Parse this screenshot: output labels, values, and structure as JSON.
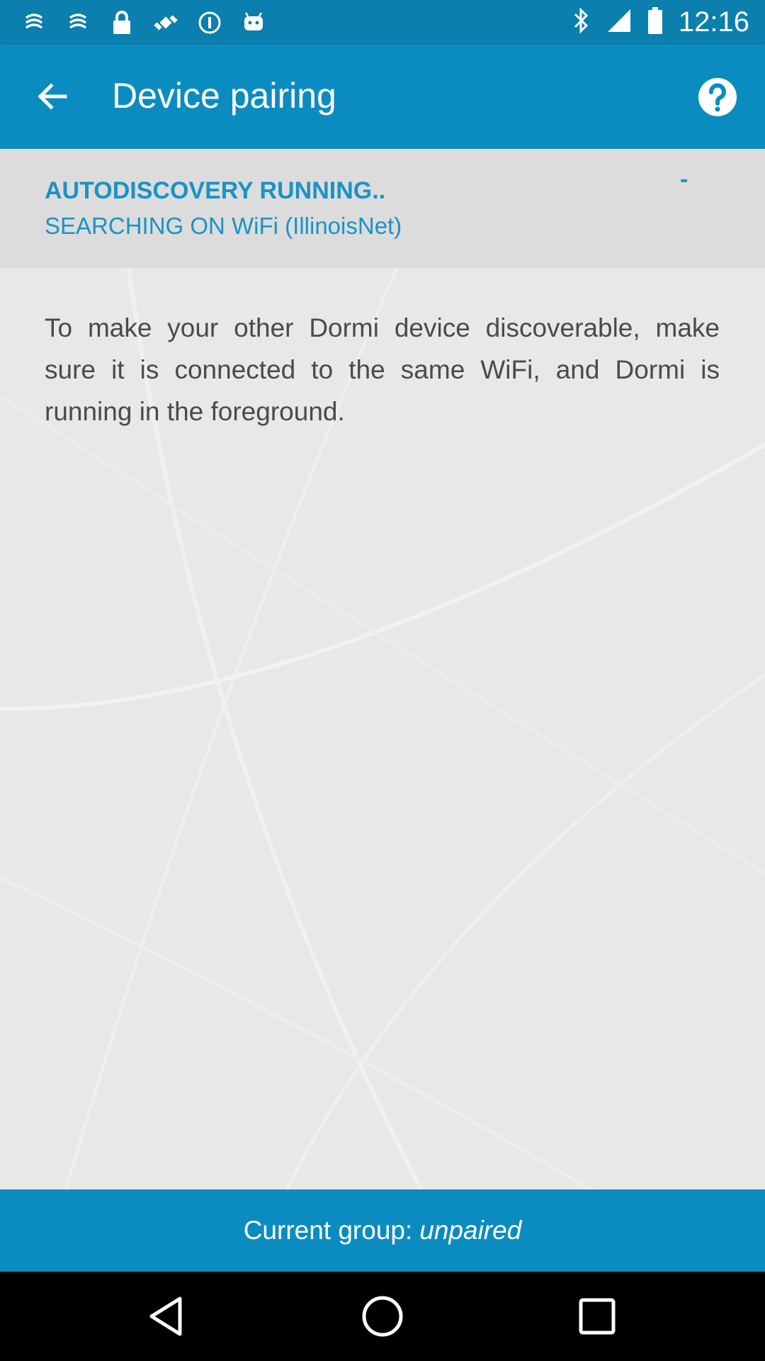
{
  "status_bar": {
    "time": "12:16",
    "left_icons": [
      "notification-swirl-icon",
      "notification-swirl-icon",
      "lock-icon",
      "fake-gps-icon",
      "info-circle-icon",
      "android-icon"
    ],
    "right_icons": [
      "bluetooth-icon",
      "signal-icon",
      "battery-icon"
    ]
  },
  "app_bar": {
    "title": "Device pairing",
    "back_icon": "arrow-back-icon",
    "help_icon": "help-icon"
  },
  "discovery": {
    "status": "AUTODISCOVERY RUNNING..",
    "network": "SEARCHING ON WiFi (IllinoisNet)",
    "indicator": "-"
  },
  "instructions": "To make your other Dormi device discoverable, make sure it is connected to the same WiFi, and Dormi is running in the foreground.",
  "footer": {
    "label": "Current group:",
    "value": "unpaired"
  },
  "nav_bar": {
    "buttons": [
      "back-triangle-icon",
      "home-circle-icon",
      "recents-square-icon"
    ]
  },
  "colors": {
    "primary": "#0b8cc0",
    "status_bar": "#0b7fae",
    "accent_text": "#1a93c6",
    "body_text": "#4a4a4a",
    "background": "#e8e8e8"
  }
}
